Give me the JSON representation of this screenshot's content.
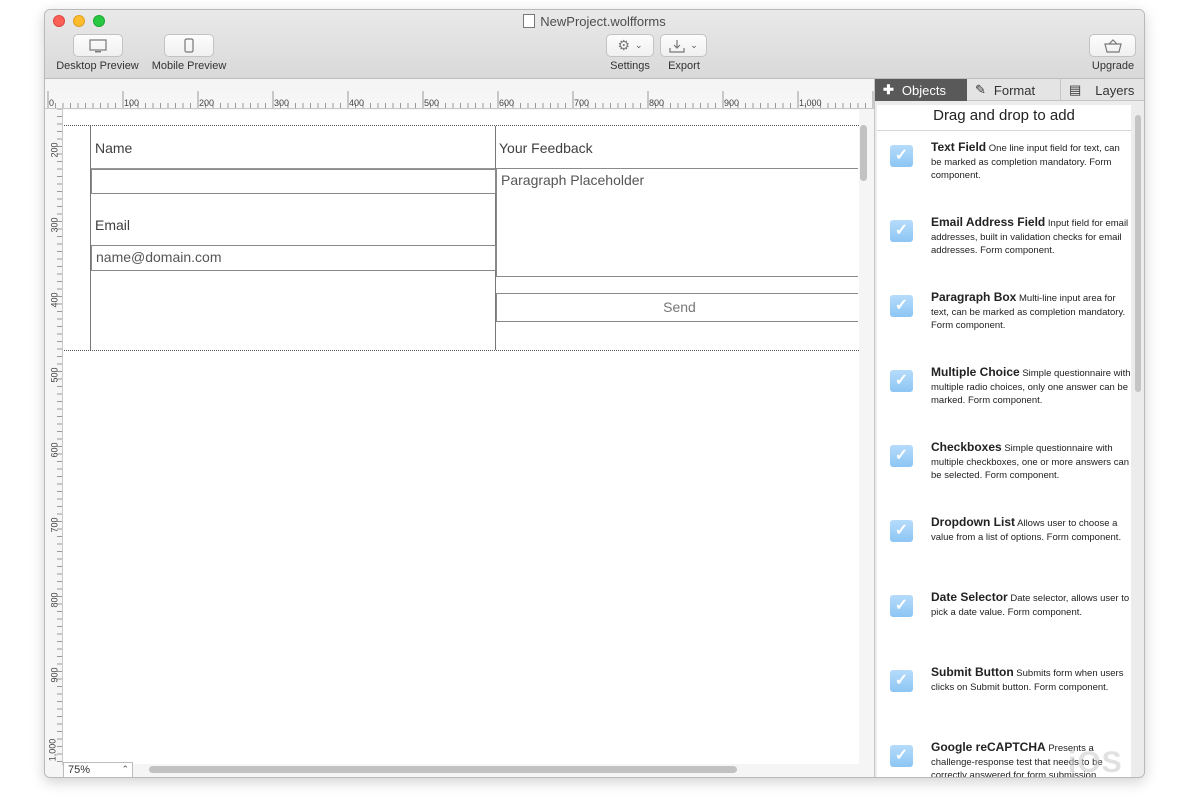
{
  "window": {
    "title": "NewProject.wolfforms"
  },
  "toolbar": {
    "desktop_preview": "Desktop Preview",
    "mobile_preview": "Mobile Preview",
    "settings": "Settings",
    "export": "Export",
    "upgrade": "Upgrade"
  },
  "ruler": {
    "top": [
      "0",
      "100",
      "200",
      "300",
      "400",
      "500",
      "600",
      "700",
      "800",
      "900",
      "1,000"
    ],
    "left": [
      "200",
      "300",
      "400",
      "500",
      "600",
      "700",
      "800",
      "900",
      "1,000"
    ]
  },
  "form": {
    "name_label": "Name",
    "name_value": "",
    "email_label": "Email",
    "email_value": "name@domain.com",
    "feedback_label": "Your Feedback",
    "paragraph_placeholder": "Paragraph Placeholder",
    "send_label": "Send"
  },
  "zoom": {
    "value": "75%"
  },
  "panel": {
    "tabs": [
      "Objects",
      "Format",
      "Layers"
    ],
    "header": "Drag and drop to add",
    "items": [
      {
        "title": "Text Field",
        "desc": "One line input field for text, can be marked as completion mandatory.  Form component."
      },
      {
        "title": "Email Address Field",
        "desc": "Input field for email addresses, built in validation checks for email addresses.  Form component."
      },
      {
        "title": "Paragraph Box",
        "desc": "Multi-line input area for text, can be marked as completion mandatory.  Form component."
      },
      {
        "title": "Multiple Choice",
        "desc": "Simple questionnaire with multiple radio choices, only one answer can be marked.  Form component."
      },
      {
        "title": "Checkboxes",
        "desc": "Simple questionnaire with multiple checkboxes, one or more answers can be selected.  Form component."
      },
      {
        "title": "Dropdown List",
        "desc": "Allows user to choose a value from a list of options.  Form component."
      },
      {
        "title": "Date Selector",
        "desc": "Date selector, allows user to pick a date value.  Form component."
      },
      {
        "title": "Submit Button",
        "desc": "Submits form when users clicks on Submit button.  Form component."
      },
      {
        "title": "Google reCAPTCHA",
        "desc": "Presents a challenge-response test that needs to be correctly answered for form submission."
      }
    ]
  },
  "watermark": "iOS"
}
